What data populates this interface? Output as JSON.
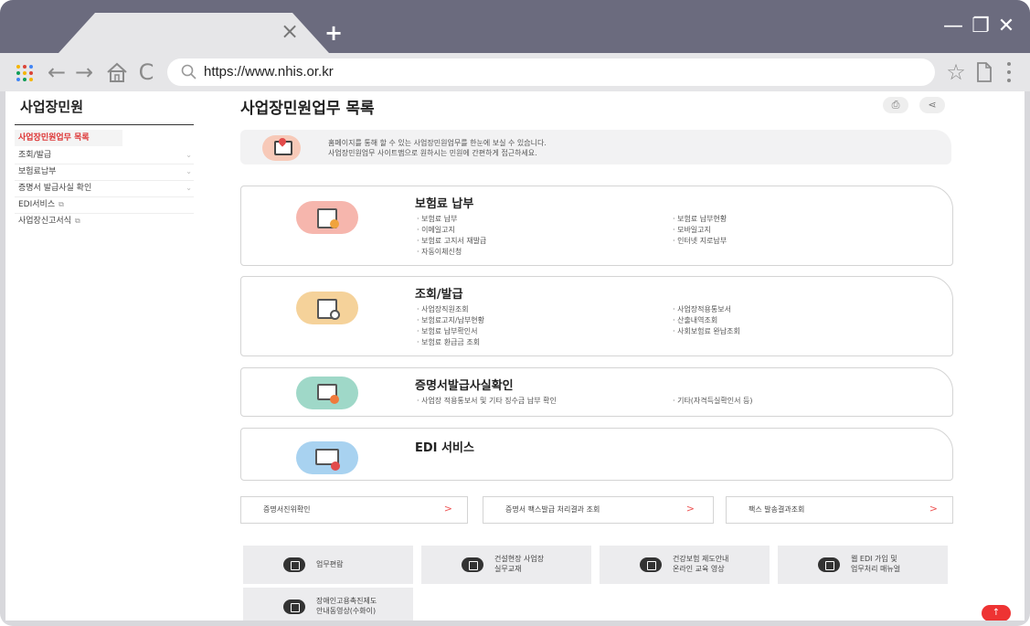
{
  "browser": {
    "url": "https://www.nhis.or.kr",
    "new_tab": "+",
    "tab_close": "×",
    "minimize": "—",
    "restore": "❐",
    "close": "✕",
    "back": "←",
    "forward": "→",
    "reload": "C",
    "star": "☆",
    "dots_colors": [
      "#f4b400",
      "#db4437",
      "#4285f4",
      "#0f9d58",
      "#f4b400",
      "#db4437",
      "#4285f4",
      "#0f9d58",
      "#f4b400"
    ]
  },
  "sidebar": {
    "title": "사업장민원",
    "items": [
      {
        "label": "사업장민원업무 목록",
        "active": true
      },
      {
        "label": "조회/발급",
        "chevron": "⌄"
      },
      {
        "label": "보험료납부",
        "chevron": "⌄"
      },
      {
        "label": "증명서 발급사실 확인",
        "chevron": "⌄"
      },
      {
        "label": "EDI서비스",
        "ext": "⧉"
      },
      {
        "label": "사업장신고서식",
        "ext": "⧉"
      }
    ]
  },
  "main": {
    "title": "사업장민원업무 목록",
    "print_icon": "⎙",
    "share_icon": "⋖",
    "notice": [
      "홈페이지를 통해 할 수 있는 사업장민원업무를 한눈에 보실 수 있습니다.",
      "사업장민원업무 사이트맵으로 원하시는 민원에 간편하게 접근하세요."
    ],
    "cards": [
      {
        "title": "보험료 납부",
        "left": [
          "· 보험료 납부",
          "· 이메일고지",
          "· 보험료 고지서 재발급",
          "· 자동이체신청"
        ],
        "right": [
          "· 보험료 납부현황",
          "· 모바일고지",
          "· 인터넷 지로납부"
        ]
      },
      {
        "title": "조회/발급",
        "left": [
          "· 사업장직원조회",
          "· 보험료고지/납부현황",
          "· 보험료 납부확인서",
          "· 보험료 환급금 조회"
        ],
        "right": [
          "· 사업장적용통보서",
          "· 산출내역조회",
          "· 사회보험료 완납조회"
        ]
      },
      {
        "title": "증명서발급사실확인",
        "left": [
          "· 사업장 적용통보서 및 기타 징수금 납부 확인"
        ],
        "right": [
          "· 기타(자격득실확인서 등)"
        ]
      },
      {
        "title": "EDI 서비스",
        "left": [],
        "right": []
      }
    ],
    "links": [
      {
        "label": "증명서진위확인",
        "arrow": ">"
      },
      {
        "label": "증명서 팩스발급 처리결과 조회",
        "arrow": ">"
      },
      {
        "label": "팩스 발송결과조회",
        "arrow": ">"
      }
    ],
    "quick": [
      {
        "lines": [
          "업무편람"
        ]
      },
      {
        "lines": [
          "건설현장 사업장",
          "실무교재"
        ]
      },
      {
        "lines": [
          "건강보험 제도안내",
          "온라인 교육 영상"
        ]
      },
      {
        "lines": [
          "웹 EDI 가입 및",
          "업무처리 매뉴얼"
        ]
      },
      {
        "lines": [
          "장애인고용촉진제도",
          "안내동영상(수화이)"
        ]
      }
    ],
    "top_button": "↑"
  },
  "colors": {
    "titlebar": "#6b6b7e",
    "accent_red": "#e33333",
    "card_icon_1": "#f6b6ad",
    "card_icon_2": "#f5d29a",
    "card_icon_3": "#9fd8c8",
    "card_icon_4": "#a8d2f0"
  }
}
